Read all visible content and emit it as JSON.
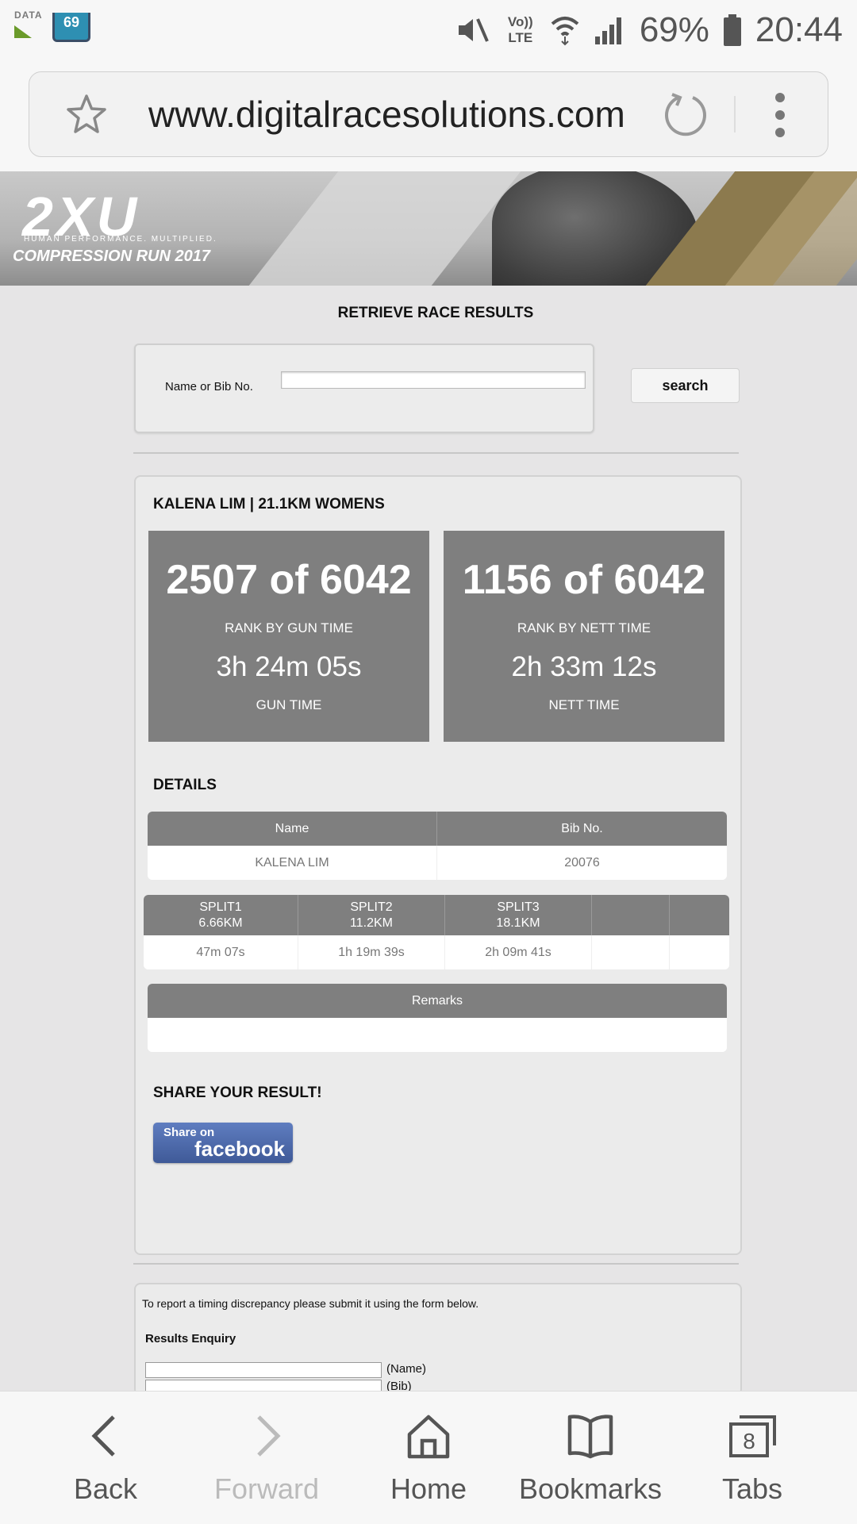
{
  "status_bar": {
    "data_label": "DATA",
    "notification_count": "69",
    "network": "Vo)) LTE",
    "battery": "69%",
    "time": "20:44"
  },
  "browser": {
    "url": "www.digitalracesolutions.com"
  },
  "banner": {
    "logo": "2XU",
    "tagline": "HUMAN PERFORMANCE. MULTIPLIED.",
    "event": "COMPRESSION RUN 2017"
  },
  "search": {
    "title": "RETRIEVE RACE RESULTS",
    "label": "Name or Bib No.",
    "value": "",
    "button": "search"
  },
  "result": {
    "heading": "KALENA LIM | 21.1KM WOMENS",
    "gun": {
      "rank": "2507 of 6042",
      "rank_label": "RANK BY GUN TIME",
      "time": "3h 24m 05s",
      "time_label": "GUN TIME"
    },
    "nett": {
      "rank": "1156 of 6042",
      "rank_label": "RANK BY NETT TIME",
      "time": "2h 33m 12s",
      "time_label": "NETT TIME"
    },
    "details_title": "DETAILS",
    "details": {
      "headers": [
        "Name",
        "Bib No."
      ],
      "values": [
        "KALENA LIM",
        "20076"
      ]
    },
    "splits": {
      "headers": [
        [
          "SPLIT1",
          "6.66KM"
        ],
        [
          "SPLIT2",
          "11.2KM"
        ],
        [
          "SPLIT3",
          "18.1KM"
        ]
      ],
      "values": [
        "47m 07s",
        "1h 19m 39s",
        "2h 09m 41s"
      ]
    },
    "remarks_header": "Remarks",
    "remarks_value": "",
    "share_title": "SHARE YOUR RESULT!",
    "share_small": "Share on",
    "share_big": "facebook"
  },
  "enquiry": {
    "note": "To report a timing discrepancy please submit it using the form below.",
    "title": "Results Enquiry",
    "name_label": "(Name)",
    "bib_label": "(Bib)"
  },
  "bottom_nav": {
    "back": "Back",
    "forward": "Forward",
    "home": "Home",
    "bookmarks": "Bookmarks",
    "tabs": "Tabs",
    "tabs_count": "8"
  },
  "colors": {
    "panel_grey": "#7f7f7f",
    "page_bg": "#e6e5e6",
    "facebook_blue": "#3f5a98"
  }
}
